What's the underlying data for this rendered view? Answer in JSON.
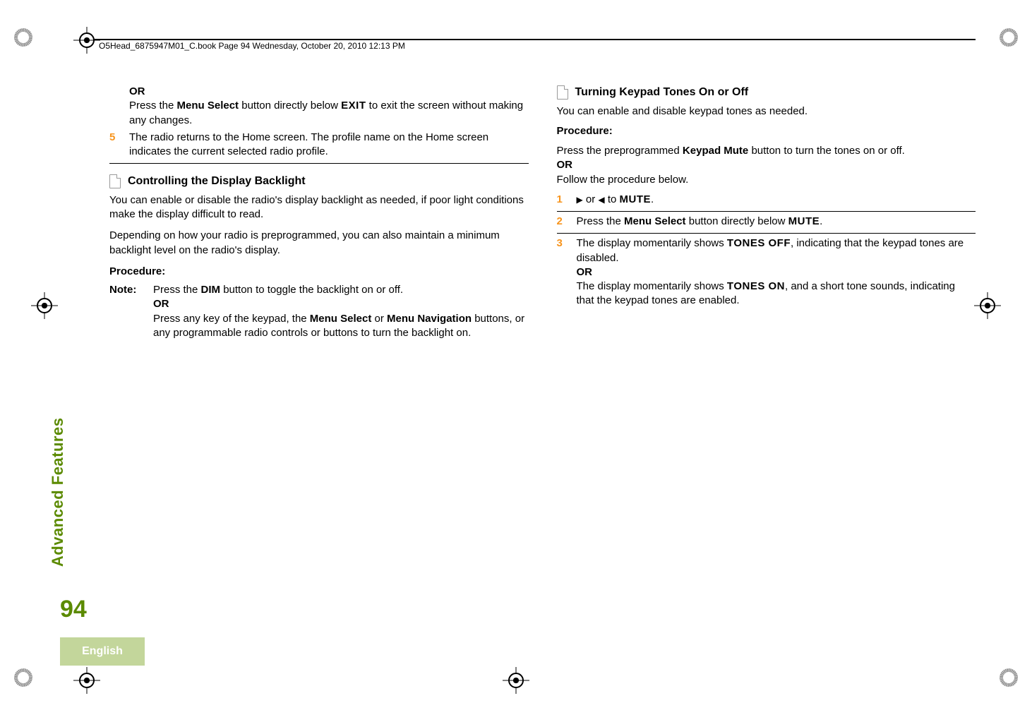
{
  "header": "O5Head_6875947M01_C.book  Page 94  Wednesday, October 20, 2010  12:13 PM",
  "left": {
    "orLabel": "OR",
    "orText1a": "Press the ",
    "orText1b": "Menu Select",
    "orText1c": " button directly below ",
    "exit": "EXIT",
    "orText1d": " to exit the screen without making any changes.",
    "step5num": "5",
    "step5": "The radio returns to the Home screen. The profile name on the Home screen indicates the current selected radio profile.",
    "h1": "Controlling the Display Backlight",
    "p1": "You can enable or disable the radio's display backlight as needed, if poor light conditions make the display difficult to read.",
    "p2": "Depending on how your radio is preprogrammed, you can also maintain a minimum backlight level on the radio's display.",
    "proc": "Procedure:",
    "noteLabel": "Note:",
    "note1a": "Press the ",
    "note1b": "DIM",
    "note1c": " button to toggle the backlight on or off.",
    "noteOr": "OR",
    "note2a": "Press any key of the keypad, the ",
    "note2b": "Menu Select",
    "note2c": " or ",
    "note2d": "Menu Navigation",
    "note2e": " buttons, or any programmable radio controls or buttons to turn the backlight on."
  },
  "right": {
    "h1": "Turning Keypad Tones On or Off",
    "p1": "You can enable and disable keypad tones as needed.",
    "proc": "Procedure:",
    "pre1a": "Press the preprogrammed ",
    "pre1b": "Keypad Mute",
    "pre1c": " button to turn the tones on or off.",
    "or": "OR",
    "pre2": "Follow the procedure below.",
    "s1num": "1",
    "s1a": " or ",
    "s1b": " to ",
    "mute": "MUTE",
    "dot": ".",
    "s2num": "2",
    "s2a": "Press the ",
    "s2b": "Menu Select",
    "s2c": " button directly below ",
    "s3num": "3",
    "s3a": "The display momentarily shows ",
    "tonesOff": "TONES OFF",
    "s3b": ", indicating that the keypad tones are disabled.",
    "s3or": "OR",
    "s3c": "The display momentarily shows ",
    "tonesOn": "TONES ON",
    "s3d": ", and a short tone sounds, indicating that the keypad tones are enabled."
  },
  "side": {
    "tab": "Advanced Features",
    "page": "94",
    "lang": "English"
  },
  "glyph": {
    "right": "▶",
    "left": "◀"
  }
}
